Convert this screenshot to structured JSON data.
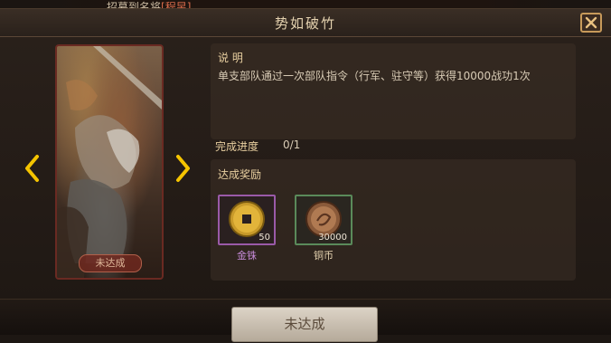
{
  "ticker": {
    "prefix": "招募到名将",
    "highlight": "[程昱]"
  },
  "dialog": {
    "title": "势如破竹"
  },
  "card": {
    "status": "未达成"
  },
  "description": {
    "heading": "说 明",
    "text": "单支部队通过一次部队指令（行军、驻守等）获得10000战功1次"
  },
  "progress": {
    "label": "完成进度",
    "value": "0/1"
  },
  "rewards": {
    "heading": "达成奖励",
    "items": [
      {
        "name": "金铢",
        "qty": "50",
        "icon": "gold-coin-icon"
      },
      {
        "name": "铜币",
        "qty": "30000",
        "icon": "copper-coin-icon"
      }
    ]
  },
  "action": {
    "label": "未达成"
  },
  "colors": {
    "gold_frame": "#9a5aa8",
    "copper_frame": "#5a8a5a",
    "arrow": "#f5c400"
  }
}
